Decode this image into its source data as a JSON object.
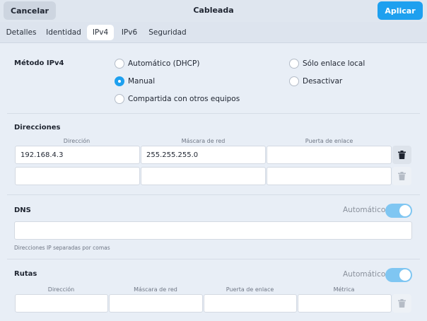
{
  "header": {
    "cancel_label": "Cancelar",
    "title": "Cableada",
    "apply_label": "Aplicar"
  },
  "tabs": [
    {
      "label": "Detalles",
      "active": false
    },
    {
      "label": "Identidad",
      "active": false
    },
    {
      "label": "IPv4",
      "active": true
    },
    {
      "label": "IPv6",
      "active": false
    },
    {
      "label": "Seguridad",
      "active": false
    }
  ],
  "method": {
    "heading": "Método IPv4",
    "options": [
      {
        "label": "Automático (DHCP)",
        "checked": false
      },
      {
        "label": "Manual",
        "checked": true
      },
      {
        "label": "Compartida con otros equipos",
        "checked": false
      },
      {
        "label": "Sólo enlace local",
        "checked": false
      },
      {
        "label": "Desactivar",
        "checked": false
      }
    ]
  },
  "addresses": {
    "heading": "Direcciones",
    "columns": [
      "Dirección",
      "Máscara de red",
      "Puerta de enlace"
    ],
    "rows": [
      [
        "192.168.4.3",
        "255.255.255.0",
        ""
      ],
      [
        "",
        "",
        ""
      ]
    ]
  },
  "dns": {
    "heading": "DNS",
    "auto_label": "Automático",
    "auto_on": true,
    "value": "",
    "hint": "Direcciones IP separadas por comas"
  },
  "routes": {
    "heading": "Rutas",
    "auto_label": "Automático",
    "auto_on": true,
    "columns": [
      "Dirección",
      "Máscara de red",
      "Puerta de enlace",
      "Métrica"
    ],
    "rows": [
      [
        "",
        "",
        "",
        ""
      ]
    ]
  },
  "colors": {
    "accent": "#1ea0ef",
    "background": "#e8eef6",
    "headerbar": "#dfe6ef"
  }
}
